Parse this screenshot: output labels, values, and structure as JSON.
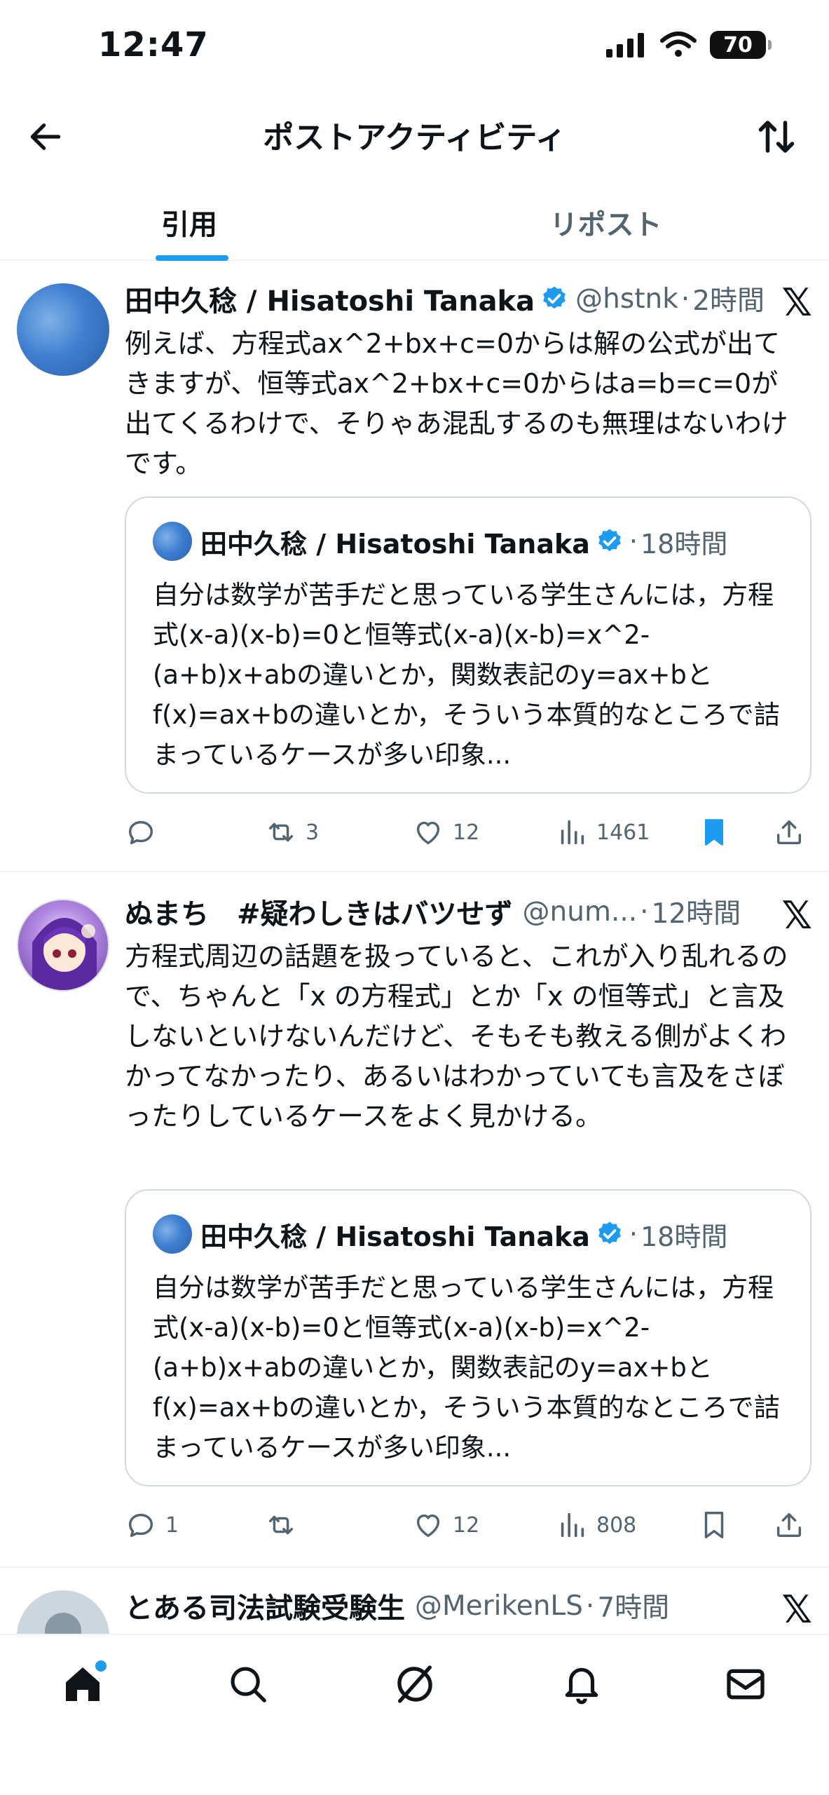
{
  "status_bar": {
    "time": "12:47",
    "battery": "70"
  },
  "header": {
    "title": "ポストアクティビティ"
  },
  "tabs": [
    {
      "label": "引用"
    },
    {
      "label": "リポスト"
    }
  ],
  "posts": [
    {
      "name": "田中久稔 / Hisatoshi Tanaka",
      "handle": "@hstnk",
      "time": "2時間",
      "text": "例えば、方程式ax^2+bx+c=0からは解の公式が出てきますが、恒等式ax^2+bx+c=0からはa=b=c=0が出てくるわけで、そりゃあ混乱するのも無理はないわけです。",
      "quote": {
        "name": "田中久稔 / Hisatoshi Tanaka",
        "time": "18時間",
        "text": "自分は数学が苦手だと思っている学生さんには，方程式(x-a)(x-b)=0と恒等式(x-a)(x-b)=x^2-(a+b)x+abの違いとか，関数表記のy=ax+bとf(x)=ax+bの違いとか，そういう本質的なところで詰まっているケースが多い印象..."
      },
      "replies": "",
      "reposts": "3",
      "likes": "12",
      "views": "1461"
    },
    {
      "name": "ぬまち　#疑わしきはバツせず",
      "handle": "@num...",
      "time": "12時間",
      "text": "方程式周辺の話題を扱っていると、これが入り乱れるので、ちゃんと「x の方程式」とか「x の恒等式」と言及しないといけないんだけど、そもそも教える側がよくわかってなかったり、あるいはわかっていても言及をさぼったりしているケースをよく見かける。",
      "quote": {
        "name": "田中久稔 / Hisatoshi Tanaka",
        "time": "18時間",
        "text": "自分は数学が苦手だと思っている学生さんには，方程式(x-a)(x-b)=0と恒等式(x-a)(x-b)=x^2-(a+b)x+abの違いとか，関数表記のy=ax+bとf(x)=ax+bの違いとか，そういう本質的なところで詰まっているケースが多い印象..."
      },
      "replies": "1",
      "reposts": "",
      "likes": "12",
      "views": "808"
    },
    {
      "name": "とある司法試験受験生",
      "handle": "@MerikenLS",
      "time": "7時間"
    }
  ],
  "separator": "·",
  "colors": {
    "accent": "#1d9bf0",
    "text": "#0f1419",
    "secondary": "#536471",
    "border": "#cfd9de"
  },
  "icons": {
    "back": "arrow-left-icon",
    "sort": "sort-icon",
    "verified": "verified-badge-icon",
    "x_logo": "x-logo-icon",
    "reply": "reply-icon",
    "repost": "repost-icon",
    "like": "heart-icon",
    "views": "views-icon",
    "bookmark": "bookmark-icon",
    "share": "share-icon",
    "home": "home-icon",
    "search": "search-icon",
    "grok": "grok-icon",
    "notifications": "bell-icon",
    "messages": "mail-icon"
  }
}
